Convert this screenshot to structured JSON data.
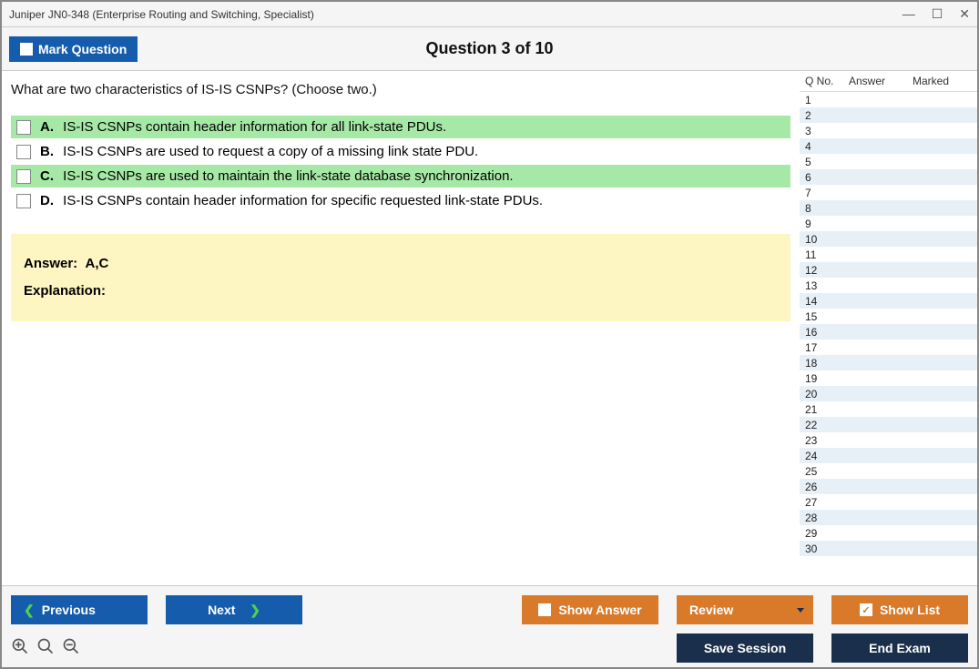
{
  "window": {
    "title": "Juniper JN0-348 (Enterprise Routing and Switching, Specialist)"
  },
  "header": {
    "mark_label": "Mark Question",
    "counter": "Question 3 of 10"
  },
  "question": {
    "text": "What are two characteristics of IS-IS CSNPs? (Choose two.)",
    "options": [
      {
        "letter": "A.",
        "text": "IS-IS CSNPs contain header information for all link-state PDUs.",
        "correct": true
      },
      {
        "letter": "B.",
        "text": "IS-IS CSNPs are used to request a copy of a missing link state PDU.",
        "correct": false
      },
      {
        "letter": "C.",
        "text": "IS-IS CSNPs are used to maintain the link-state database synchronization.",
        "correct": true
      },
      {
        "letter": "D.",
        "text": "IS-IS CSNPs contain header information for specific requested link-state PDUs.",
        "correct": false
      }
    ],
    "answer_label": "Answer:",
    "answer_value": "A,C",
    "explanation_label": "Explanation:",
    "explanation_text": ""
  },
  "sidebar": {
    "col_qno": "Q No.",
    "col_answer": "Answer",
    "col_marked": "Marked",
    "rows": [
      1,
      2,
      3,
      4,
      5,
      6,
      7,
      8,
      9,
      10,
      11,
      12,
      13,
      14,
      15,
      16,
      17,
      18,
      19,
      20,
      21,
      22,
      23,
      24,
      25,
      26,
      27,
      28,
      29,
      30
    ]
  },
  "footer": {
    "prev": "Previous",
    "next": "Next",
    "show_answer": "Show Answer",
    "review": "Review",
    "show_list": "Show List",
    "save_session": "Save Session",
    "end_exam": "End Exam"
  }
}
